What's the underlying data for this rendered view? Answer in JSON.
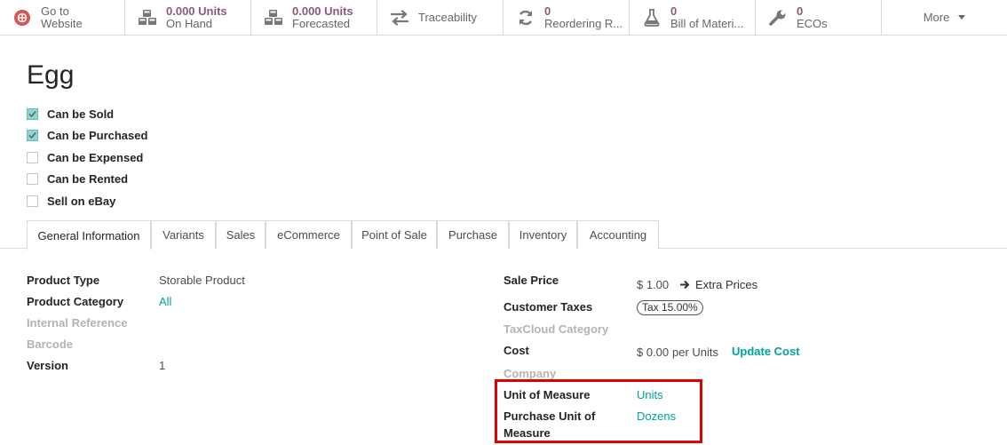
{
  "smart_buttons": [
    {
      "value": "",
      "label_line1": "Go to",
      "label_line2": "Website",
      "icon": "globe-icon"
    },
    {
      "value": "0.000 Units",
      "label": "On Hand",
      "icon": "cubes-icon"
    },
    {
      "value": "0.000 Units",
      "label": "Forecasted",
      "icon": "cubes-icon"
    },
    {
      "value": "",
      "label": "Traceability",
      "icon": "exchange-icon"
    },
    {
      "value": "0",
      "label": "Reordering R...",
      "icon": "refresh-icon"
    },
    {
      "value": "0",
      "label": "Bill of Materi...",
      "icon": "flask-icon"
    },
    {
      "value": "0",
      "label": "ECOs",
      "icon": "wrench-icon"
    }
  ],
  "more_label": "More",
  "product": {
    "name": "Egg"
  },
  "checkboxes": [
    {
      "label": "Can be Sold",
      "checked": true
    },
    {
      "label": "Can be Purchased",
      "checked": true
    },
    {
      "label": "Can be Expensed",
      "checked": false
    },
    {
      "label": "Can be Rented",
      "checked": false
    },
    {
      "label": "Sell on eBay",
      "checked": false
    }
  ],
  "tabs": [
    "General Information",
    "Variants",
    "Sales",
    "eCommerce",
    "Point of Sale",
    "Purchase",
    "Inventory",
    "Accounting"
  ],
  "active_tab": "General Information",
  "left_fields": {
    "product_type_label": "Product Type",
    "product_type_value": "Storable Product",
    "product_category_label": "Product Category",
    "product_category_value": "All",
    "internal_reference_label": "Internal Reference",
    "barcode_label": "Barcode",
    "version_label": "Version",
    "version_value": "1"
  },
  "right_fields": {
    "sale_price_label": "Sale Price",
    "sale_price_value": "$ 1.00",
    "extra_prices_label": "Extra Prices",
    "customer_taxes_label": "Customer Taxes",
    "customer_taxes_badge": "Tax 15.00%",
    "taxcloud_label": "TaxCloud Category",
    "cost_label": "Cost",
    "cost_value": "$ 0.00",
    "cost_per": "per Units",
    "update_cost_label": "Update Cost",
    "company_label": "Company",
    "uom_label": "Unit of Measure",
    "uom_value": "Units",
    "purchase_uom_label_line1": "Purchase Unit of",
    "purchase_uom_label_line2": "Measure",
    "purchase_uom_value": "Dozens"
  },
  "colors": {
    "accent": "#00a09d",
    "smart_value": "#875a7b",
    "checkbox_on": "#8fd4d3",
    "highlight": "#e00000"
  }
}
